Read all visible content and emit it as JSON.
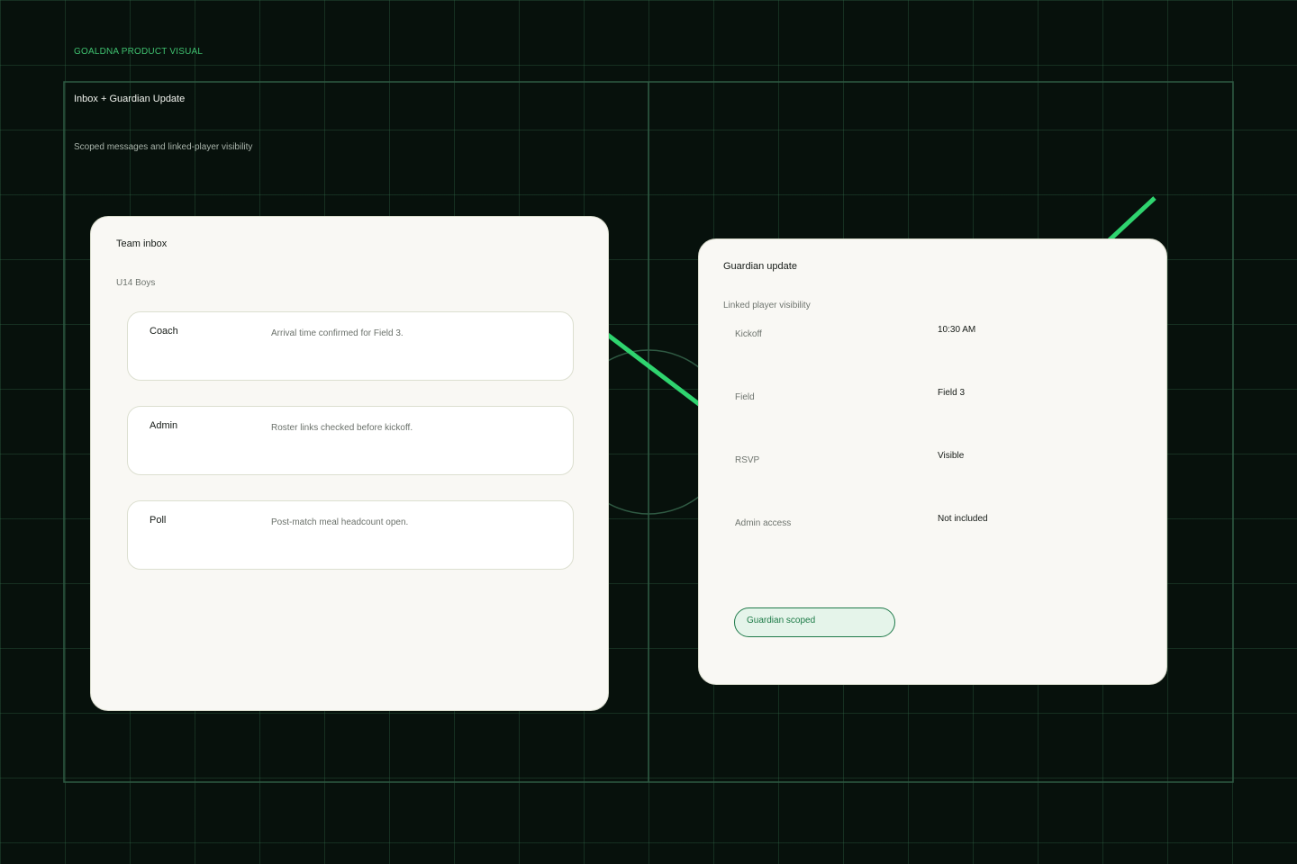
{
  "header": {
    "eyebrow": "GOALDNA PRODUCT VISUAL",
    "title": "Inbox + Guardian Update",
    "subtitle": "Scoped messages and linked-player visibility"
  },
  "inbox": {
    "title": "Team inbox",
    "team": "U14 Boys",
    "messages": [
      {
        "sender": "Coach",
        "text": "Arrival time confirmed for Field 3."
      },
      {
        "sender": "Admin",
        "text": "Roster links checked before kickoff."
      },
      {
        "sender": "Poll",
        "text": "Post-match meal headcount open."
      }
    ]
  },
  "guardian": {
    "title": "Guardian update",
    "subtitle": "Linked player visibility",
    "rows": [
      {
        "label": "Kickoff",
        "value": "10:30 AM"
      },
      {
        "label": "Field",
        "value": "Field 3"
      },
      {
        "label": "RSVP",
        "value": "Visible"
      },
      {
        "label": "Admin access",
        "value": "Not included"
      }
    ],
    "badge": "Guardian scoped"
  },
  "colors": {
    "background": "#07110c",
    "grid": "#1e3a2a",
    "accent": "#2fd46f",
    "card": "#f9f8f4",
    "badge_border": "#1f7a4a",
    "badge_fill": "#e5f4ea"
  }
}
